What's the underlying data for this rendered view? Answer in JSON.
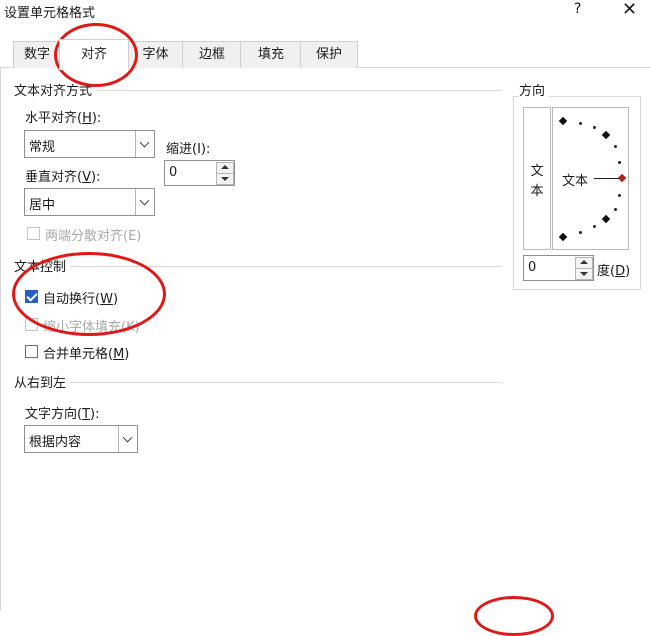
{
  "window": {
    "title": "设置单元格格式",
    "help": "?",
    "close": "✕"
  },
  "tabs": [
    {
      "label": "数字"
    },
    {
      "label": "对齐"
    },
    {
      "label": "字体"
    },
    {
      "label": "边框"
    },
    {
      "label": "填充"
    },
    {
      "label": "保护"
    }
  ],
  "alignment": {
    "group_title": "文本对齐方式",
    "horizontal": {
      "label_pre": "水平对齐(",
      "key": "H",
      "label_post": "):",
      "value": "常规"
    },
    "indent": {
      "label": "缩进(I):",
      "value": "0"
    },
    "vertical": {
      "label_pre": "垂直对齐(",
      "key": "V",
      "label_post": "):",
      "value": "居中"
    },
    "justify_distributed": "两端分散对齐(E)"
  },
  "orientation": {
    "group_title": "方向",
    "vertical_text": [
      "文",
      "本"
    ],
    "dial_text": "文本",
    "degrees_value": "0",
    "degrees_label_pre": "度(",
    "degrees_key": "D",
    "degrees_label_post": ")"
  },
  "text_control": {
    "group_title": "文本控制",
    "wrap_text": {
      "label_pre": "自动换行(",
      "key": "W",
      "label_post": ")",
      "checked": true
    },
    "shrink_to_fit": {
      "label": "缩小字体填充(K)",
      "checked": false,
      "disabled": true
    },
    "merge_cells": {
      "label_pre": "合并单元格(",
      "key": "M",
      "label_post": ")",
      "checked": false
    }
  },
  "rtl": {
    "group_title": "从右到左",
    "direction": {
      "label_pre": "文字方向(",
      "key": "T",
      "label_post": "):",
      "value": "根据内容"
    }
  },
  "colors": {
    "annotation": "#e01818",
    "check_accent": "#2060c8"
  }
}
